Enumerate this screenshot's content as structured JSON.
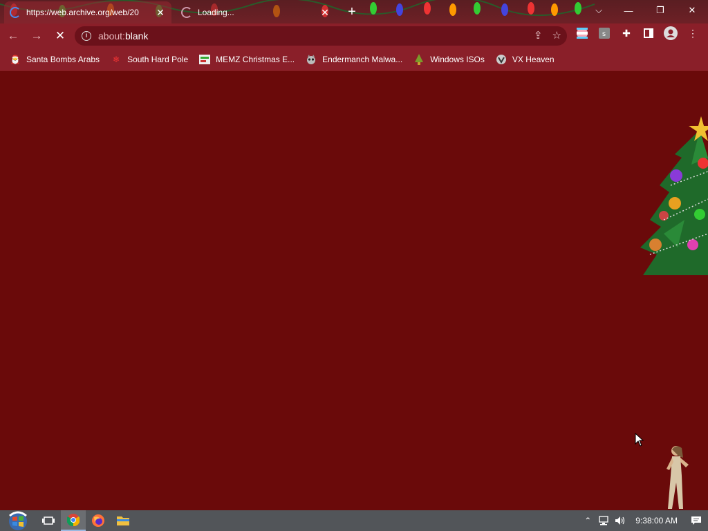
{
  "tabs": [
    {
      "title": "https://web.archive.org/web/20",
      "close": "✕"
    },
    {
      "title": "Loading...",
      "close": "✕"
    }
  ],
  "new_tab_label": "+",
  "window_controls": {
    "tab_search": "⌵",
    "minimize": "—",
    "restore": "❐",
    "close": "✕"
  },
  "address_bar": {
    "scheme": "about:",
    "host": "blank"
  },
  "bookmarks": [
    {
      "label": "Santa Bombs Arabs",
      "icon": "santa-icon"
    },
    {
      "label": "South Hard Pole",
      "icon": "snowflake-icon"
    },
    {
      "label": "MEMZ Christmas E...",
      "icon": "memz-icon"
    },
    {
      "label": "Endermanch Malwa...",
      "icon": "raccoon-icon"
    },
    {
      "label": "Windows ISOs",
      "icon": "tree-icon"
    },
    {
      "label": "VX Heaven",
      "icon": "vx-icon"
    }
  ],
  "taskbar": {
    "time": "9:38:00 AM"
  },
  "colors": {
    "content_bg": "#6a0a0a",
    "toolbar_bg": "#8a1f29",
    "taskbar_bg": "#525559"
  }
}
